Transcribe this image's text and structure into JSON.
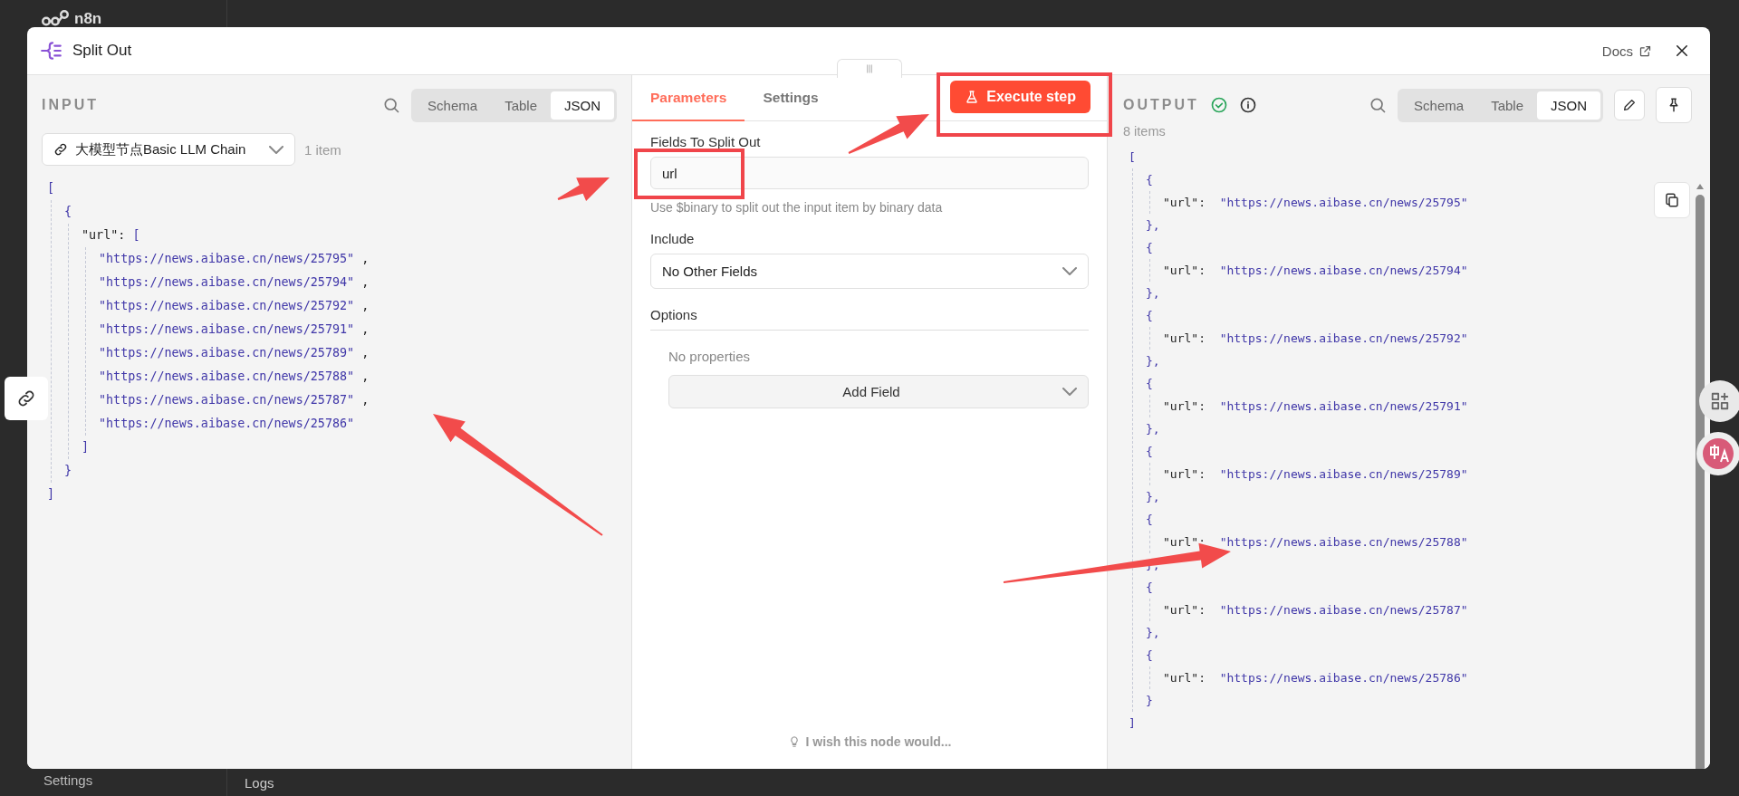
{
  "background": {
    "logo": "n8n",
    "sidebar_item": "Settings",
    "bottom_tab": "Logs"
  },
  "modal": {
    "title": "Split Out",
    "docs_link": "Docs"
  },
  "input": {
    "label": "INPUT",
    "view_tabs": [
      {
        "label": "Schema",
        "selected": false
      },
      {
        "label": "Table",
        "selected": false
      },
      {
        "label": "JSON",
        "selected": true
      }
    ],
    "source": "大模型节点Basic LLM Chain",
    "count": "1 item",
    "json": [
      {
        "value": "[",
        "children": [
          {
            "value": "{",
            "children": [
              {
                "key": "\"url\": ",
                "value": "[",
                "children": [
                  {
                    "value": "\"https://news.aibase.cn/news/25795\"",
                    "tail": " ,"
                  },
                  {
                    "value": "\"https://news.aibase.cn/news/25794\"",
                    "tail": " ,"
                  },
                  {
                    "value": "\"https://news.aibase.cn/news/25792\"",
                    "tail": " ,"
                  },
                  {
                    "value": "\"https://news.aibase.cn/news/25791\"",
                    "tail": " ,"
                  },
                  {
                    "value": "\"https://news.aibase.cn/news/25789\"",
                    "tail": " ,"
                  },
                  {
                    "value": "\"https://news.aibase.cn/news/25788\"",
                    "tail": " ,"
                  },
                  {
                    "value": "\"https://news.aibase.cn/news/25787\"",
                    "tail": " ,"
                  },
                  {
                    "value": "\"https://news.aibase.cn/news/25786\""
                  }
                ]
              },
              {
                "value": "]"
              }
            ]
          },
          {
            "value": "}"
          }
        ]
      },
      {
        "value": "]"
      }
    ]
  },
  "parameters": {
    "tabs": [
      {
        "label": "Parameters",
        "selected": true
      },
      {
        "label": "Settings",
        "selected": false
      }
    ],
    "execute_button": "Execute step",
    "split_field": {
      "label": "Fields To Split Out",
      "value": "url",
      "hint": "Use $binary to split out the input item by binary data"
    },
    "include": {
      "label": "Include",
      "value": "No Other Fields"
    },
    "options": {
      "label": "Options",
      "empty": "No properties",
      "add_button": "Add Field"
    },
    "feedback": "I wish this node would..."
  },
  "output": {
    "label": "OUTPUT",
    "view_tabs": [
      {
        "label": "Schema",
        "selected": false
      },
      {
        "label": "Table",
        "selected": false
      },
      {
        "label": "JSON",
        "selected": true
      }
    ],
    "count": "8 items",
    "json": [
      {
        "value": "[",
        "children": [
          {
            "value": "{",
            "children": [
              {
                "key": "\"url\":  ",
                "value": "\"https://news.aibase.cn/news/25795\""
              }
            ]
          },
          {
            "value": "},"
          },
          {
            "value": "{",
            "children": [
              {
                "key": "\"url\":  ",
                "value": "\"https://news.aibase.cn/news/25794\""
              }
            ]
          },
          {
            "value": "},"
          },
          {
            "value": "{",
            "children": [
              {
                "key": "\"url\":  ",
                "value": "\"https://news.aibase.cn/news/25792\""
              }
            ]
          },
          {
            "value": "},"
          },
          {
            "value": "{",
            "children": [
              {
                "key": "\"url\":  ",
                "value": "\"https://news.aibase.cn/news/25791\""
              }
            ]
          },
          {
            "value": "},"
          },
          {
            "value": "{",
            "children": [
              {
                "key": "\"url\":  ",
                "value": "\"https://news.aibase.cn/news/25789\""
              }
            ]
          },
          {
            "value": "},"
          },
          {
            "value": "{",
            "children": [
              {
                "key": "\"url\":  ",
                "value": "\"https://news.aibase.cn/news/25788\""
              }
            ]
          },
          {
            "value": "},"
          },
          {
            "value": "{",
            "children": [
              {
                "key": "\"url\":  ",
                "value": "\"https://news.aibase.cn/news/25787\""
              }
            ]
          },
          {
            "value": "},"
          },
          {
            "value": "{",
            "children": [
              {
                "key": "\"url\":  ",
                "value": "\"https://news.aibase.cn/news/25786\""
              }
            ]
          },
          {
            "value": "}"
          }
        ]
      },
      {
        "value": "]"
      }
    ]
  }
}
